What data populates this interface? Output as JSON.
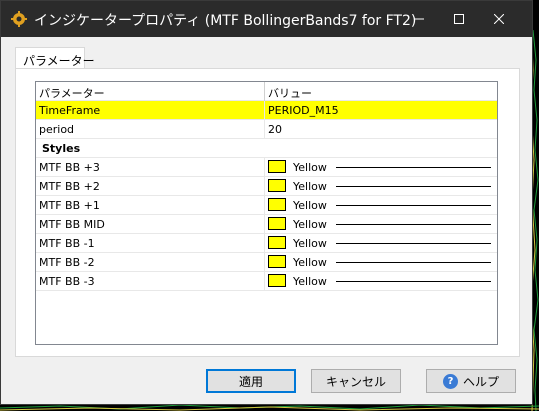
{
  "window": {
    "title": "インジケータープロパティ (MTF BollingerBands7 for FT2)",
    "controls": {
      "minimize": "minimize",
      "maximize": "maximize",
      "close": "close"
    }
  },
  "tabs": [
    {
      "label": "パラメーター",
      "active": true
    }
  ],
  "grid": {
    "columns": [
      "パラメーター",
      "バリュー"
    ],
    "params": [
      {
        "name": "TimeFrame",
        "value": "PERIOD_M15",
        "selected": true
      },
      {
        "name": "period",
        "value": "20",
        "selected": false
      }
    ],
    "group_label": "Styles",
    "styles": [
      {
        "name": "MTF BB +3",
        "color_name": "Yellow",
        "color": "#ffff00"
      },
      {
        "name": "MTF BB +2",
        "color_name": "Yellow",
        "color": "#ffff00"
      },
      {
        "name": "MTF BB +1",
        "color_name": "Yellow",
        "color": "#ffff00"
      },
      {
        "name": "MTF BB MID",
        "color_name": "Yellow",
        "color": "#ffff00"
      },
      {
        "name": "MTF BB -1",
        "color_name": "Yellow",
        "color": "#ffff00"
      },
      {
        "name": "MTF BB -2",
        "color_name": "Yellow",
        "color": "#ffff00"
      },
      {
        "name": "MTF BB -3",
        "color_name": "Yellow",
        "color": "#ffff00"
      }
    ]
  },
  "buttons": {
    "ok": "適用",
    "cancel": "キャンセル",
    "help": "ヘルプ"
  },
  "colors": {
    "selection": "#ffff00",
    "titlebar": "#2b2b2b",
    "default_button_border": "#0078d7"
  }
}
